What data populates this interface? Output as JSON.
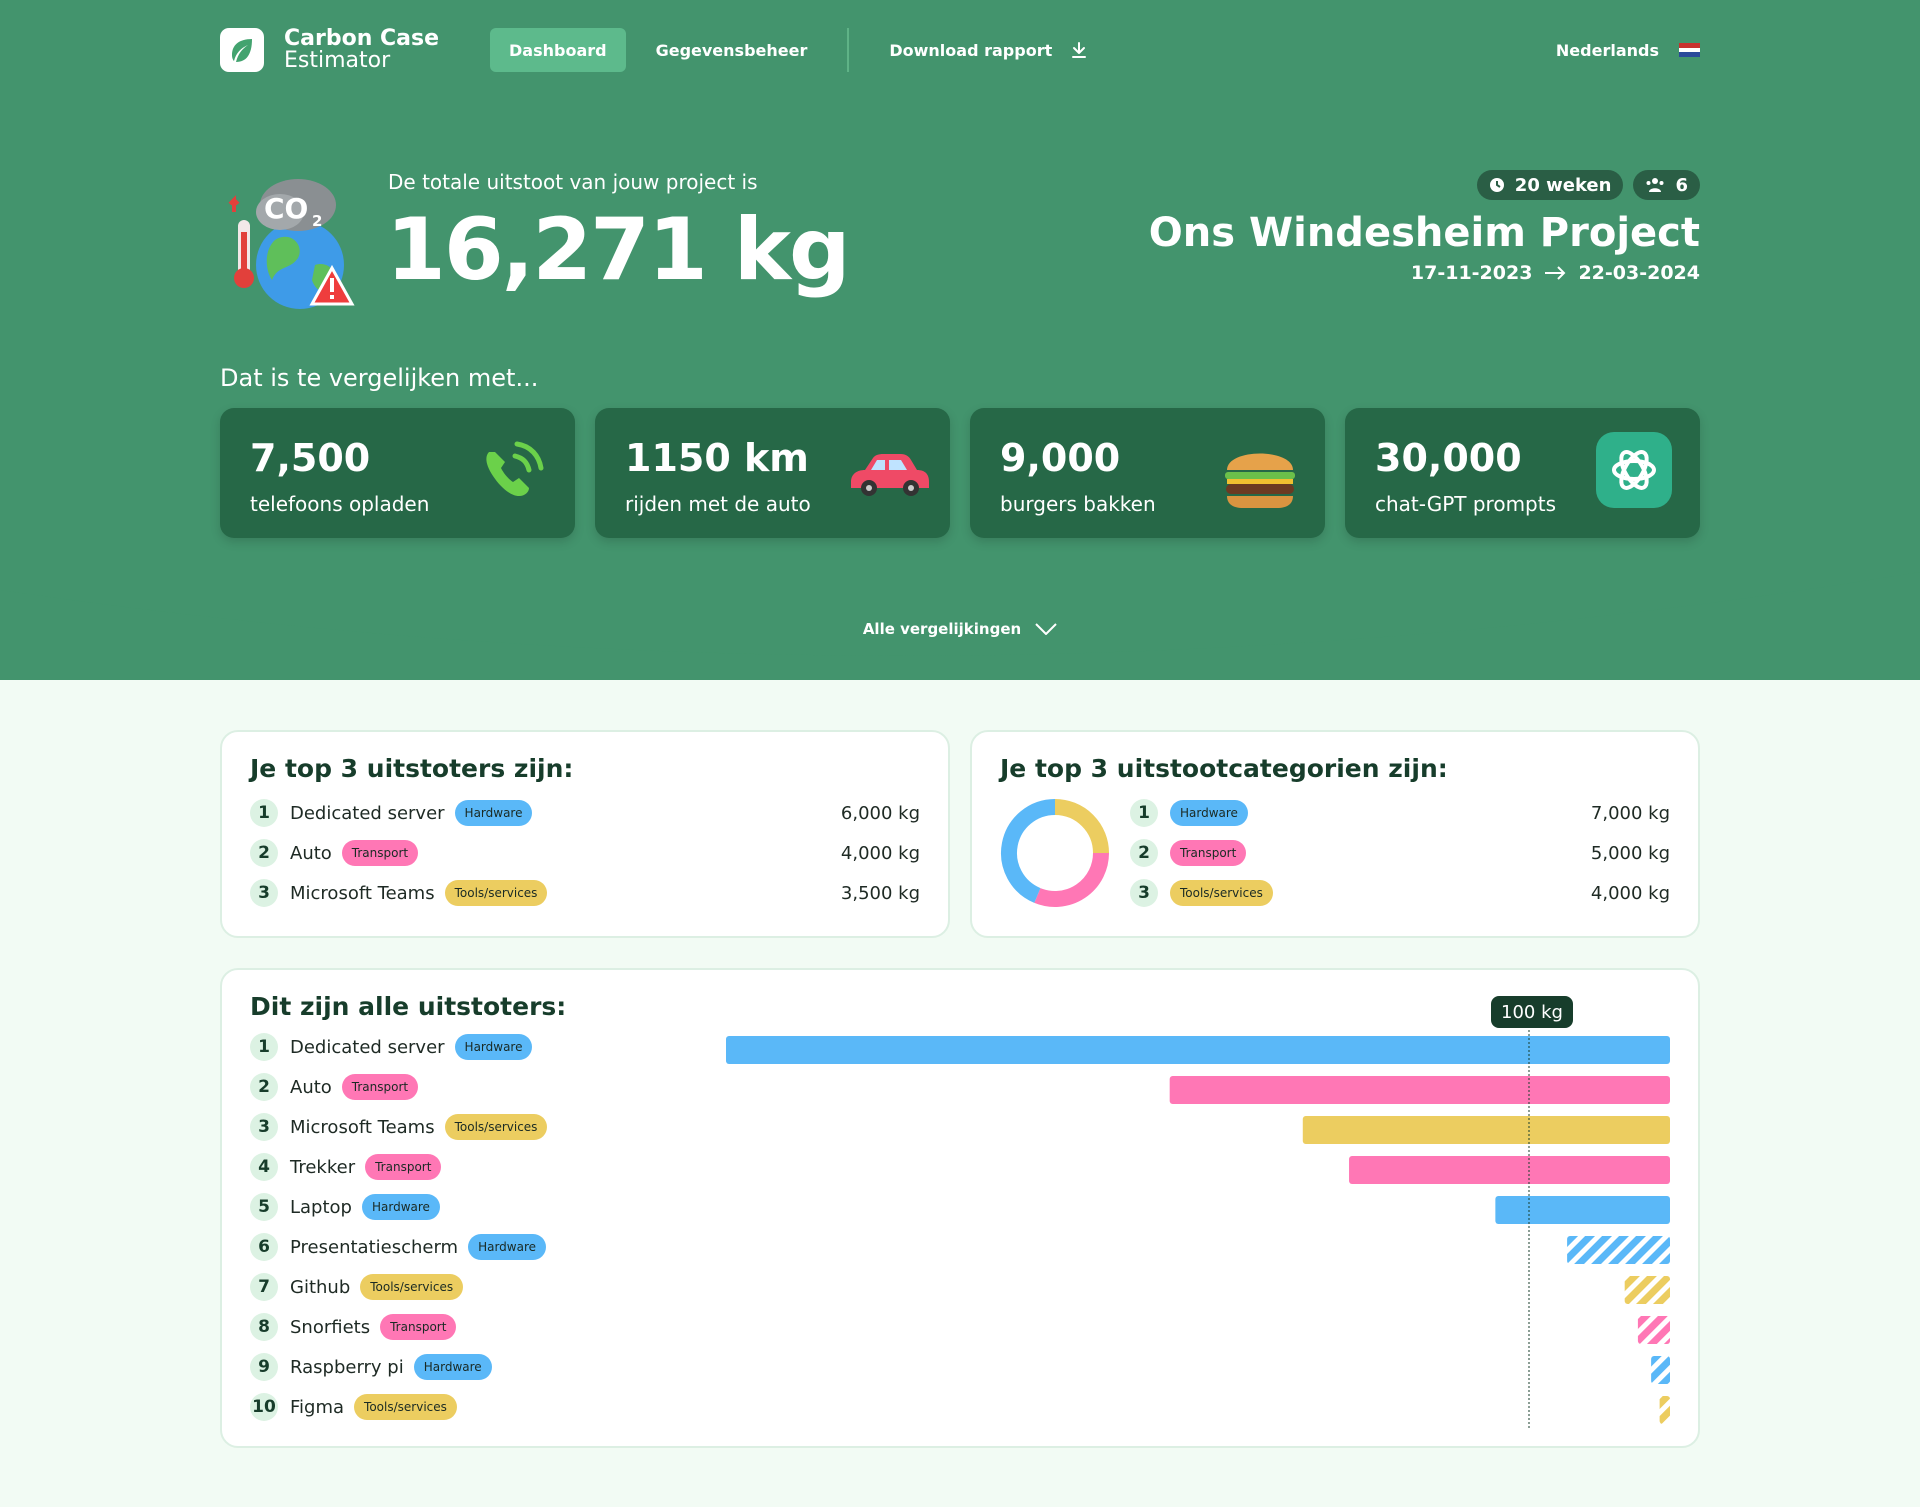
{
  "app": {
    "name_line1": "Carbon Case",
    "name_line2": "Estimator"
  },
  "nav": {
    "dashboard": "Dashboard",
    "data_management": "Gegevensbeheer",
    "download": "Download rapport",
    "language": "Nederlands"
  },
  "hero": {
    "subtitle": "De totale uitstoot van jouw project is",
    "total": "16,271 kg",
    "weeks": "20 weken",
    "members": "6",
    "project_name": "Ons Windesheim Project",
    "date_start": "17-11-2023",
    "date_end": "22-03-2024",
    "compare_label": "Dat is te vergelijken met...",
    "all_comparisons": "Alle vergelijkingen"
  },
  "comparisons": [
    {
      "value": "7,500",
      "label": "telefoons opladen",
      "icon": "phone-icon"
    },
    {
      "value": "1150 km",
      "label": "rijden met de auto",
      "icon": "car-icon"
    },
    {
      "value": "9,000",
      "label": "burgers bakken",
      "icon": "burger-icon"
    },
    {
      "value": "30,000",
      "label": "chat-GPT prompts",
      "icon": "chatgpt-icon"
    }
  ],
  "top_emitters": {
    "title": "Je top 3 uitstoters zijn:",
    "items": [
      {
        "rank": "1",
        "name": "Dedicated server",
        "category": "Hardware",
        "amount": "6,000 kg"
      },
      {
        "rank": "2",
        "name": "Auto",
        "category": "Transport",
        "amount": "4,000 kg"
      },
      {
        "rank": "3",
        "name": "Microsoft Teams",
        "category": "Tools/services",
        "amount": "3,500 kg"
      }
    ]
  },
  "top_categories": {
    "title": "Je top 3 uitstootcategorien zijn:",
    "items": [
      {
        "rank": "1",
        "category": "Hardware",
        "amount": "7,000 kg",
        "value": 7000
      },
      {
        "rank": "2",
        "category": "Transport",
        "amount": "5,000 kg",
        "value": 5000
      },
      {
        "rank": "3",
        "category": "Tools/services",
        "amount": "4,000 kg",
        "value": 4000
      }
    ]
  },
  "colors": {
    "Hardware": "#5ab8f8",
    "Transport": "#ff77b5",
    "Tools/services": "#eccd60",
    "hero": "#43946d",
    "card": "#266847",
    "dark": "#173d2b"
  },
  "all_emitters": {
    "title": "Dit zijn alle uitstoters:",
    "reference_label": "100 kg",
    "items": [
      {
        "rank": "1",
        "name": "Dedicated server",
        "category": "Hardware",
        "fraction": 1.0,
        "striped": false
      },
      {
        "rank": "2",
        "name": "Auto",
        "category": "Transport",
        "fraction": 0.53,
        "striped": false
      },
      {
        "rank": "3",
        "name": "Microsoft Teams",
        "category": "Tools/services",
        "fraction": 0.389,
        "striped": false
      },
      {
        "rank": "4",
        "name": "Trekker",
        "category": "Transport",
        "fraction": 0.34,
        "striped": false
      },
      {
        "rank": "5",
        "name": "Laptop",
        "category": "Hardware",
        "fraction": 0.185,
        "striped": false
      },
      {
        "rank": "6",
        "name": "Presentatiescherm",
        "category": "Hardware",
        "fraction": 0.109,
        "striped": true
      },
      {
        "rank": "7",
        "name": "Github",
        "category": "Tools/services",
        "fraction": 0.048,
        "striped": true
      },
      {
        "rank": "8",
        "name": "Snorfiets",
        "category": "Transport",
        "fraction": 0.034,
        "striped": true
      },
      {
        "rank": "9",
        "name": "Raspberry pi",
        "category": "Hardware",
        "fraction": 0.02,
        "striped": true
      },
      {
        "rank": "10",
        "name": "Figma",
        "category": "Tools/services",
        "fraction": 0.011,
        "striped": true
      }
    ]
  }
}
